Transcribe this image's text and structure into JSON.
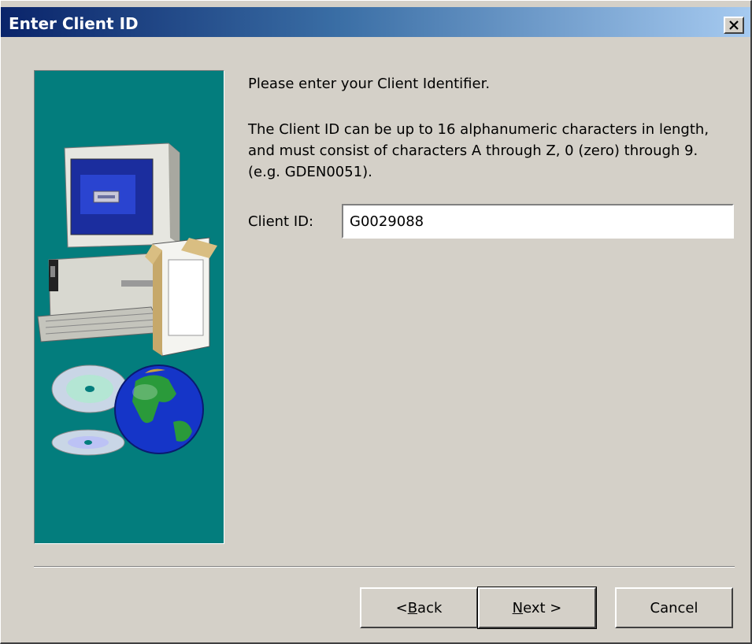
{
  "window": {
    "title": "Enter Client ID",
    "close_icon": "close-x-icon"
  },
  "side_panel": {
    "background_color": "#037d7d",
    "illustration": "computer-box-globe-cds-illustration"
  },
  "content": {
    "prompt": "Please enter your Client Identifier.",
    "description": "The Client ID can be up to 16 alphanumeric characters in length, and must consist of characters A through Z, 0 (zero) through 9. (e.g. GDEN0051).",
    "client_id_label": "Client ID:",
    "client_id_value": "G0029088"
  },
  "buttons": {
    "back": {
      "prefix": "< ",
      "mnemonic": "B",
      "suffix": "ack"
    },
    "next": {
      "prefix": "",
      "mnemonic": "N",
      "suffix": "ext >"
    },
    "cancel": {
      "label": "Cancel"
    }
  }
}
